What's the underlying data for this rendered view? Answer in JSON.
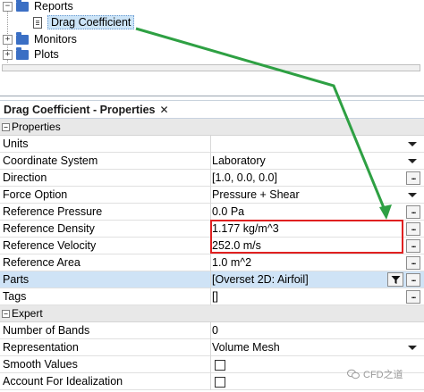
{
  "tree": {
    "items": [
      {
        "label": "Reports",
        "icon": "folder-icon",
        "expander": "−"
      },
      {
        "label": "Drag Coefficient",
        "icon": "report-doc-icon",
        "selected": true
      },
      {
        "label": "Monitors",
        "icon": "folder-icon",
        "expander": "+"
      },
      {
        "label": "Plots",
        "icon": "folder-icon",
        "expander": "+"
      }
    ]
  },
  "properties": {
    "title": "Drag Coefficient - Properties",
    "close_label": "✕",
    "categories": [
      {
        "label": "Properties",
        "toggle": "−",
        "rows": [
          {
            "name": "Units",
            "value": "",
            "control": "dropdown"
          },
          {
            "name": "Coordinate System",
            "value": "Laboratory",
            "control": "dropdown"
          },
          {
            "name": "Direction",
            "value": "[1.0, 0.0, 0.0]",
            "control": "ellipsis"
          },
          {
            "name": "Force Option",
            "value": "Pressure + Shear",
            "control": "dropdown"
          },
          {
            "name": "Reference Pressure",
            "value": "0.0 Pa",
            "control": "ellipsis"
          },
          {
            "name": "Reference Density",
            "value": "1.177 kg/m^3",
            "control": "ellipsis"
          },
          {
            "name": "Reference Velocity",
            "value": "252.0 m/s",
            "control": "ellipsis"
          },
          {
            "name": "Reference Area",
            "value": "1.0 m^2",
            "control": "ellipsis"
          },
          {
            "name": "Parts",
            "value": "[Overset 2D: Airfoil]",
            "control": "filter-ellipsis",
            "selected": true
          },
          {
            "name": "Tags",
            "value": "[]",
            "control": "ellipsis"
          }
        ]
      },
      {
        "label": "Expert",
        "toggle": "−",
        "rows": [
          {
            "name": "Number of Bands",
            "value": "0",
            "control": "none"
          },
          {
            "name": "Representation",
            "value": "Volume Mesh",
            "control": "dropdown"
          },
          {
            "name": "Smooth Values",
            "value": "",
            "control": "checkbox"
          },
          {
            "name": "Account For Idealization",
            "value": "",
            "control": "checkbox"
          }
        ]
      }
    ]
  },
  "annotation": {
    "highlight_color": "#e02020",
    "arrow_color": "#2ea043"
  },
  "watermark": {
    "text": "CFD之道"
  }
}
